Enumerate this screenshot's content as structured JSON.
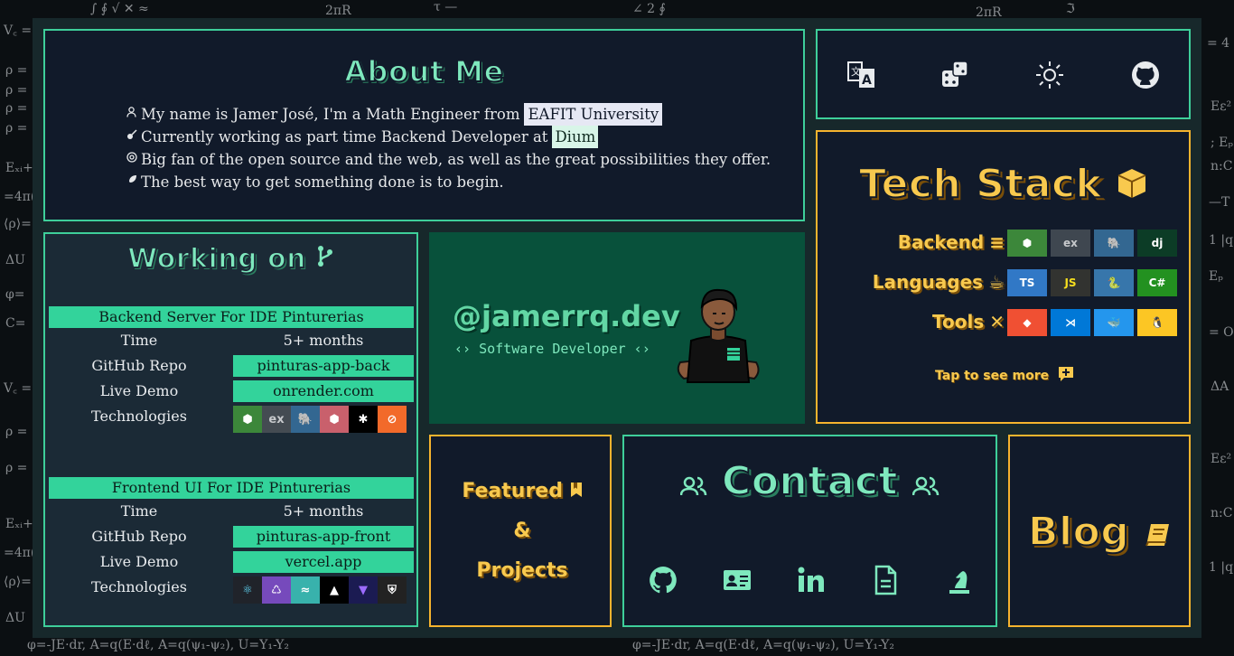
{
  "about": {
    "title": "About Me",
    "lines": [
      {
        "text": "My name is Jamer José, I'm a Math Engineer from ",
        "highlight": "EAFIT University"
      },
      {
        "text": "Currently working as part time Backend Developer at ",
        "highlight": "Dium"
      },
      {
        "text": "Big fan of the open source and the web, as well as the great possibilities they offer.",
        "highlight": ""
      },
      {
        "text": " The best way to get something done is to begin.",
        "highlight": ""
      }
    ],
    "line_icons": [
      "user-icon",
      "guitar-icon",
      "opensource-icon",
      "feather-icon"
    ]
  },
  "toolbar": {
    "icons": [
      "translate-icon",
      "dice-icon",
      "sun-icon",
      "github-icon"
    ]
  },
  "tech_stack": {
    "title": "Tech Stack",
    "title_icon": "cube-icon",
    "rows": [
      {
        "label": "Backend",
        "icon": "server-icon",
        "badges": [
          {
            "name": "nodejs",
            "text": "⬢",
            "bg": "#3c873a",
            "fg": "#ffffff"
          },
          {
            "name": "express",
            "text": "ex",
            "bg": "#3f4750",
            "fg": "#c7c9cc"
          },
          {
            "name": "postgresql",
            "text": "🐘",
            "bg": "#336791",
            "fg": "#ffffff"
          },
          {
            "name": "django",
            "text": "dj",
            "bg": "#0c3c26",
            "fg": "#ffffff"
          }
        ]
      },
      {
        "label": "Languages",
        "icon": "java-icon",
        "badges": [
          {
            "name": "typescript",
            "text": "TS",
            "bg": "#3178c6",
            "fg": "#ffffff"
          },
          {
            "name": "javascript",
            "text": "JS",
            "bg": "#323330",
            "fg": "#f7df1e"
          },
          {
            "name": "python",
            "text": "🐍",
            "bg": "#3776ab",
            "fg": "#ffd43b"
          },
          {
            "name": "csharp",
            "text": "C#",
            "bg": "#239120",
            "fg": "#ffffff"
          }
        ]
      },
      {
        "label": "Tools",
        "icon": "tools-icon",
        "badges": [
          {
            "name": "git",
            "text": "◆",
            "bg": "#f05033",
            "fg": "#ffffff"
          },
          {
            "name": "vscode",
            "text": "⋊",
            "bg": "#0078d7",
            "fg": "#ffffff"
          },
          {
            "name": "docker",
            "text": "🐳",
            "bg": "#2496ed",
            "fg": "#ffffff"
          },
          {
            "name": "linux",
            "text": "🐧",
            "bg": "#fcc624",
            "fg": "#000000"
          }
        ]
      }
    ],
    "cta": "Tap to see more"
  },
  "working": {
    "title": "Working on",
    "keys": {
      "time": "Time",
      "repo": "GitHub Repo",
      "demo": "Live Demo",
      "tech": "Technologies"
    },
    "projects": [
      {
        "title": "Backend Server For IDE Pinturerias",
        "time": "5+ months",
        "repo": "pinturas-app-back",
        "demo": "onrender.com",
        "technologies": [
          {
            "name": "nodejs",
            "text": "⬢",
            "bg": "#3c873a",
            "fg": "#ffffff"
          },
          {
            "name": "express",
            "text": "ex",
            "bg": "#444b52",
            "fg": "#c7c9cc"
          },
          {
            "name": "postgresql",
            "text": "🐘",
            "bg": "#336791",
            "fg": "#ffffff"
          },
          {
            "name": "sequelize",
            "text": "⬢",
            "bg": "#c9606c",
            "fg": "#ffffff"
          },
          {
            "name": "openai",
            "text": "✱",
            "bg": "#000000",
            "fg": "#ffffff"
          },
          {
            "name": "swagger",
            "text": "⊘",
            "bg": "#f26a2a",
            "fg": "#ffffff"
          }
        ]
      },
      {
        "title": "Frontend UI For IDE Pinturerias",
        "time": "5+ months",
        "repo": "pinturas-app-front",
        "demo": "vercel.app",
        "technologies": [
          {
            "name": "react",
            "text": "⚛",
            "bg": "#20232a",
            "fg": "#61dafb"
          },
          {
            "name": "redux",
            "text": "♺",
            "bg": "#764abc",
            "fg": "#ffffff"
          },
          {
            "name": "tailwind",
            "text": "≈",
            "bg": "#38b2ac",
            "fg": "#ffffff"
          },
          {
            "name": "vercel",
            "text": "▲",
            "bg": "#000000",
            "fg": "#ffffff"
          },
          {
            "name": "vite",
            "text": "▼",
            "bg": "#1b1b52",
            "fg": "#9c6bff"
          },
          {
            "name": "auth0",
            "text": "⛨",
            "bg": "#222222",
            "fg": "#ffffff"
          }
        ]
      }
    ]
  },
  "profile": {
    "handle": "@jamerrq.dev",
    "role": "‹› Software Developer ‹›"
  },
  "featured": {
    "line1": "Featured",
    "line2": "&",
    "line3": "Projects"
  },
  "contact": {
    "title": "Contact",
    "icons": [
      "github-icon",
      "contact-card-icon",
      "linkedin-icon",
      "document-icon",
      "chess-icon"
    ]
  },
  "blog": {
    "title": "Blog"
  },
  "colors": {
    "green": "#3ecf9a",
    "yellow": "#f6b42e",
    "card_bg": "#111a2a"
  }
}
